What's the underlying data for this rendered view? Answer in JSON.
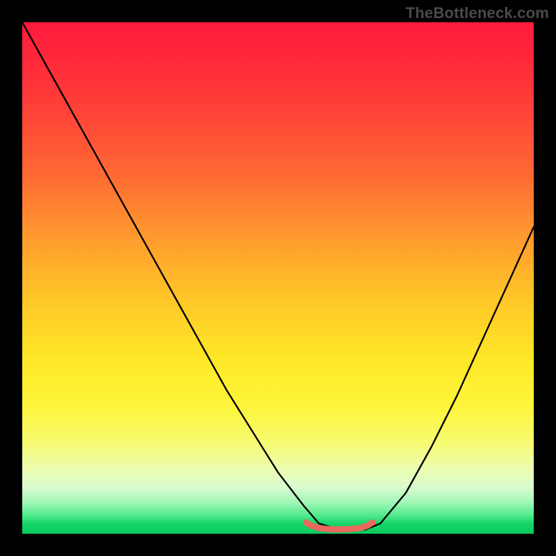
{
  "watermark": "TheBottleneck.com",
  "chart_data": {
    "type": "line",
    "title": "",
    "xlabel": "",
    "ylabel": "",
    "xlim": [
      0,
      100
    ],
    "ylim": [
      0,
      100
    ],
    "grid": false,
    "legend": false,
    "series": [
      {
        "name": "black-curve",
        "color": "#000000",
        "x": [
          0,
          5,
          10,
          15,
          20,
          25,
          30,
          35,
          40,
          45,
          50,
          55,
          58,
          62,
          67,
          70,
          75,
          80,
          85,
          90,
          95,
          100
        ],
        "values": [
          100,
          91,
          82,
          73,
          64,
          55,
          46,
          37,
          28,
          20,
          12,
          5.5,
          2,
          0.8,
          0.8,
          2,
          8,
          17,
          27,
          38,
          49,
          60
        ]
      },
      {
        "name": "red-marker",
        "color": "#e86a5e",
        "x": [
          55.5,
          56.5,
          58,
          60,
          62,
          64,
          66,
          67.5,
          68.5
        ],
        "values": [
          2.2,
          1.6,
          1.1,
          0.9,
          0.85,
          0.9,
          1.1,
          1.6,
          2.2
        ]
      }
    ],
    "gradient_stops": [
      {
        "pos": 0,
        "color": "#ff1a3c"
      },
      {
        "pos": 0.3,
        "color": "#ff6a33"
      },
      {
        "pos": 0.55,
        "color": "#ffc927"
      },
      {
        "pos": 0.75,
        "color": "#fdf53a"
      },
      {
        "pos": 0.91,
        "color": "#d9fbcf"
      },
      {
        "pos": 1.0,
        "color": "#07c95e"
      }
    ]
  }
}
